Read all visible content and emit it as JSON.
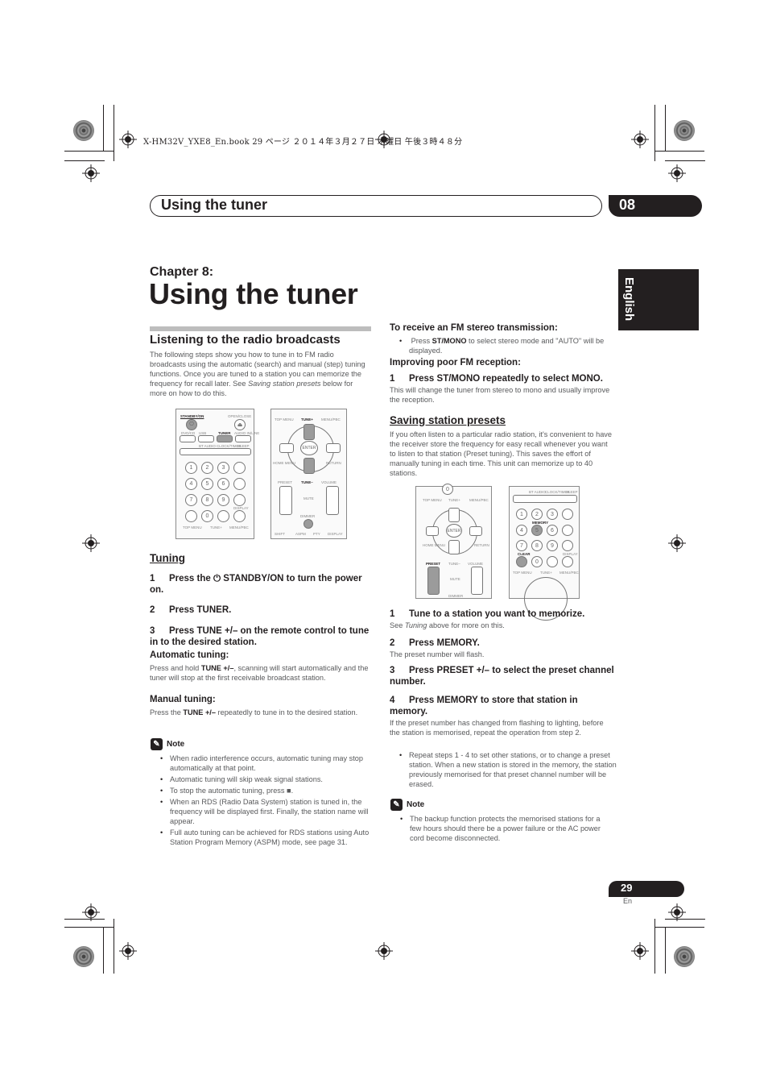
{
  "print_marks": {
    "book_line": "X-HM32V_YXE8_En.book  29 ページ  ２０１４年３月２７日  木曜日  午後３時４８分"
  },
  "header": {
    "section_title": "Using the tuner",
    "chapter_number": "08"
  },
  "language_tab": "English",
  "chapter": {
    "label": "Chapter 8:",
    "title": "Using the tuner"
  },
  "left": {
    "section_heading": "Listening to the radio broadcasts",
    "intro_before": "The following steps show you how to tune in to FM radio broadcasts using the automatic (search) and manual (step) tuning functions. Once you are tuned to a station you can memorize the frequency for recall later. See ",
    "intro_link": "Saving station presets",
    "intro_after": " below for more on how to do this.",
    "remote1": {
      "labels": [
        "STANDBY/ON",
        "OPEN/CLOSE",
        "DVD/CD",
        "USB",
        "TUNER",
        "AUDIO IN/LINE",
        "BT AUDIO",
        "CLOCK/TIMER",
        "SLEEP",
        "TOP MENU",
        "TUNE+",
        "MENU/PBC",
        "ENTER",
        "HOME MENU",
        "RETURN",
        "PRESET",
        "TUNE–",
        "VOLUME",
        "MUTE",
        "DIMMER",
        "SHIFT",
        "ASPM",
        "PTY",
        "DISPLAY"
      ],
      "digits": [
        "1",
        "2",
        "3",
        "4",
        "5",
        "6",
        "7",
        "8",
        "9",
        "0"
      ]
    },
    "tuning_heading": "Tuning",
    "steps": [
      {
        "num": "1",
        "text_before": "Press the ",
        "icon": "power-icon",
        "text_after": " STANDBY/ON to turn the power on."
      },
      {
        "num": "2",
        "text": "Press TUNER."
      },
      {
        "num": "3",
        "text": "Press TUNE +/– on the remote control to tune in to the desired station."
      }
    ],
    "automatic": {
      "heading": "Automatic tuning:",
      "before": "Press and hold ",
      "key": "TUNE +/–",
      "after": ", scanning will start automatically and the tuner will stop at the first receivable broadcast station."
    },
    "manual": {
      "heading": "Manual tuning:",
      "before": "Press the ",
      "key": "TUNE +/–",
      "after": " repeatedly to tune in to the desired station."
    },
    "note": {
      "heading": "Note",
      "items": [
        "When radio interference occurs, automatic tuning may stop automatically at that point.",
        "Automatic tuning will skip weak signal stations.",
        "To stop the automatic tuning, press ■.",
        "When an RDS (Radio Data System) station is tuned in, the frequency will be displayed first. Finally, the station name will appear.",
        "Full auto tuning can be achieved for RDS stations using Auto Station Program Memory (ASPM) mode, see page 31."
      ]
    }
  },
  "right": {
    "stereo_heading": "To receive an FM stereo transmission:",
    "stereo_bullet_before": "Press ",
    "stereo_bullet_key": "ST/MONO",
    "stereo_bullet_after": " to select stereo mode and \"AUTO\" will be displayed.",
    "poor_heading": "Improving poor FM reception:",
    "poor_step": {
      "num": "1",
      "text": "Press ST/MONO repeatedly to select MONO."
    },
    "poor_body": "This will change the tuner from stereo to mono and usually improve the reception.",
    "presets_heading": "Saving station presets",
    "presets_intro": "If you often listen to a particular radio station, it's convenient to have the receiver store the frequency for easy recall whenever you want to listen to that station (Preset tuning). This saves the effort of manually tuning in each time. This unit can memorize up to 40 stations.",
    "remote2": {
      "labels": [
        "TOP MENU",
        "TUNE+",
        "MENU/PBC",
        "ENTER",
        "HOME MENU",
        "RETURN",
        "PRESET",
        "TUNE–",
        "VOLUME",
        "MUTE",
        "DIMMER",
        "BT AUDIO",
        "CLOCK/TIMER",
        "SLEEP",
        "MEMORY",
        "CLEAR",
        "DISPLAY",
        "TOP MENU",
        "TUNE+",
        "MENU/PBC"
      ],
      "digits": [
        "1",
        "2",
        "3",
        "4",
        "5",
        "6",
        "7",
        "8",
        "9",
        "0"
      ]
    },
    "steps": [
      {
        "num": "1",
        "text": "Tune to a station you want to memorize.",
        "sub_before": "See ",
        "sub_italic": "Tuning",
        "sub_after": " above for more on this."
      },
      {
        "num": "2",
        "text": "Press MEMORY.",
        "sub": "The preset number will flash."
      },
      {
        "num": "3",
        "text": "Press PRESET +/– to select the preset channel number."
      },
      {
        "num": "4",
        "text": "Press MEMORY to store that station in memory.",
        "sub": "If the preset number has changed from flashing to lighting, before the station is memorised, repeat the operation from step 2."
      }
    ],
    "repeat_bullet": "Repeat steps 1 - 4 to set other stations, or to change a preset station. When a new station is stored in the memory, the station previously memorised for that preset channel number will be erased.",
    "note": {
      "heading": "Note",
      "items": [
        "The backup function protects the memorised stations for a few hours should there be a power failure or the AC power cord become disconnected."
      ]
    }
  },
  "footer": {
    "page_number": "29",
    "lang_code": "En"
  }
}
